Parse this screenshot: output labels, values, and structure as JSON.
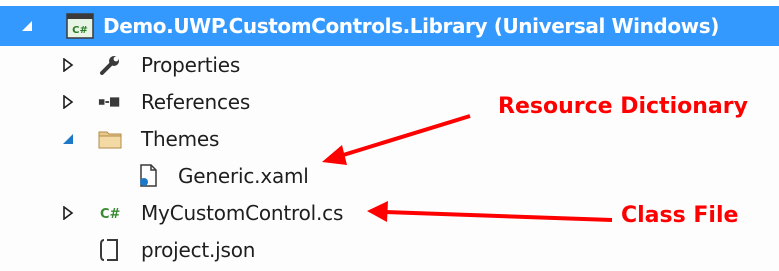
{
  "project": {
    "title": "Demo.UWP.CustomControls.Library (Universal Windows)",
    "icon": "csharp-project-icon"
  },
  "items": [
    {
      "label": "Properties",
      "icon": "wrench-icon",
      "expander": "collapsed"
    },
    {
      "label": "References",
      "icon": "references-icon",
      "expander": "collapsed"
    },
    {
      "label": "Themes",
      "icon": "folder-icon",
      "expander": "expanded"
    },
    {
      "label": "Generic.xaml",
      "icon": "xaml-file-icon",
      "expander": "none"
    },
    {
      "label": "MyCustomControl.cs",
      "icon": "csharp-file-icon",
      "expander": "collapsed"
    },
    {
      "label": "project.json",
      "icon": "json-file-icon",
      "expander": "none"
    }
  ],
  "annotations": {
    "resource_dictionary": "Resource Dictionary",
    "class_file": "Class File"
  },
  "colors": {
    "selection": "#3399ff",
    "annotation": "#ff0000",
    "text": "#1e1e1e"
  }
}
